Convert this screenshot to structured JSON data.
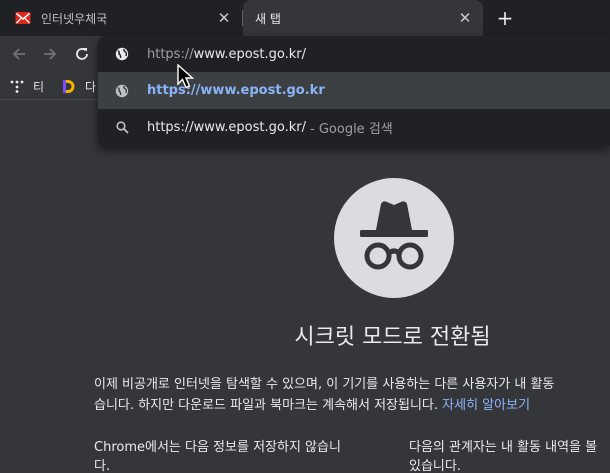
{
  "tabs": [
    {
      "title": "인터넷우체국",
      "favicon": "epost-favicon",
      "active": false
    },
    {
      "title": "새 탭",
      "favicon": "none",
      "active": true
    }
  ],
  "new_tab_symbol": "+",
  "close_symbol": "✕",
  "bookmarks": [
    {
      "label": "티",
      "icon": "dots-icon"
    },
    {
      "label": "다",
      "icon": "d-logo-icon"
    }
  ],
  "omnibox": {
    "input_scheme": "https://",
    "input_host": "www.epost.go.kr/",
    "suggestions": [
      {
        "icon": "globe-icon",
        "text": "https://www.epost.go.kr",
        "hint": ""
      },
      {
        "icon": "search-icon",
        "text": "https://www.epost.go.kr/",
        "hint": "- Google 검색"
      }
    ]
  },
  "incognito": {
    "heading": "시크릿 모드로 전환됨",
    "para_line1": "이제 비공개로 인터넷을 탐색할 수 있으며, 이 기기를 사용하는 다른 사용자가 내 활동",
    "para_line2": "습니다. 하지만 다운로드 파일과 북마크는 계속해서 저장됩니다.",
    "learn_more": "자세히 알아보기",
    "col1_line1": "Chrome에서는 다음 정보를 저장하지 않습니",
    "col1_line2": "다.",
    "col2_line1": "다음의 관계자는 내 활동 내역을 볼",
    "col2_line2": "있습니다."
  },
  "colors": {
    "tabstrip_bg": "#202124",
    "toolbar_bg": "#35363a",
    "omnibox_bg": "#202124",
    "selected_row_bg": "#3c4043",
    "link": "#8ab4f8",
    "epost_red": "#e1251b"
  }
}
